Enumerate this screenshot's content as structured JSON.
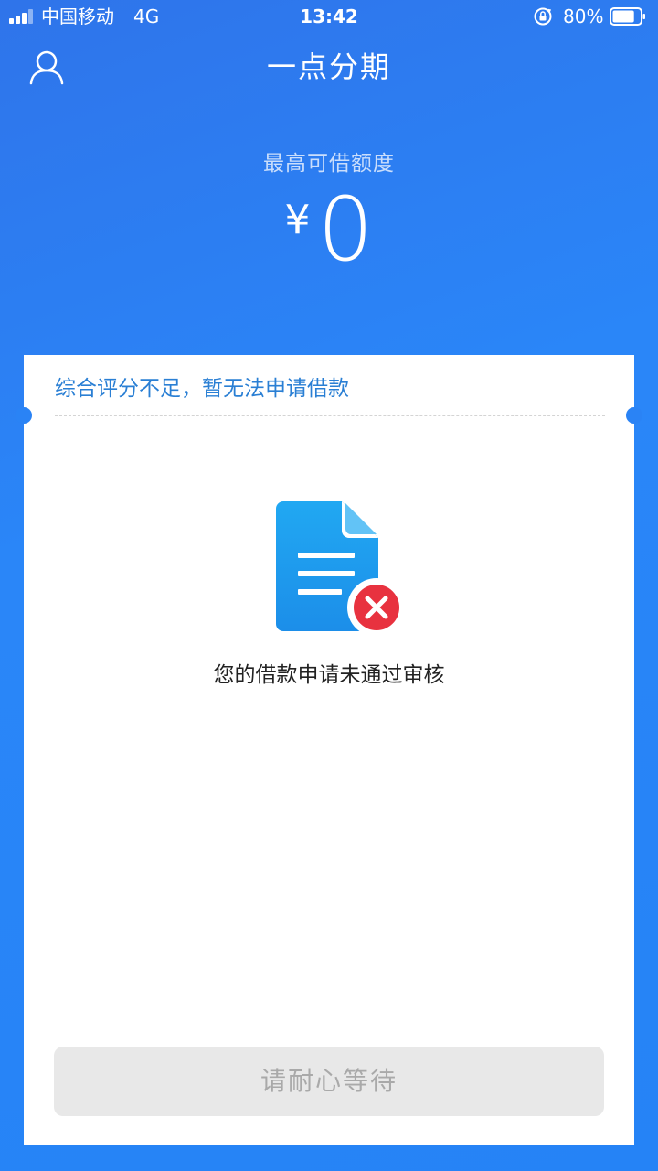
{
  "status_bar": {
    "carrier": "中国移动",
    "network": "4G",
    "time": "13:42",
    "battery_percent": "80%",
    "battery_level": 0.8,
    "signal_bars_active": 3,
    "signal_bars_total": 4
  },
  "header": {
    "title": "一点分期",
    "profile_icon": "user-icon"
  },
  "credit": {
    "label": "最高可借额度",
    "currency": "¥",
    "amount": "0"
  },
  "card": {
    "notice": "综合评分不足，暂无法申请借款",
    "icon": "document-rejected-icon",
    "message": "您的借款申请未通过审核",
    "button_label": "请耐心等待"
  },
  "colors": {
    "background": "#2a83f5",
    "notice_text": "#2a7fd4",
    "icon_blue": "#1e9ef0",
    "icon_red": "#e8323f",
    "button_bg": "#e8e8e8",
    "button_text": "#a9a9a9"
  }
}
